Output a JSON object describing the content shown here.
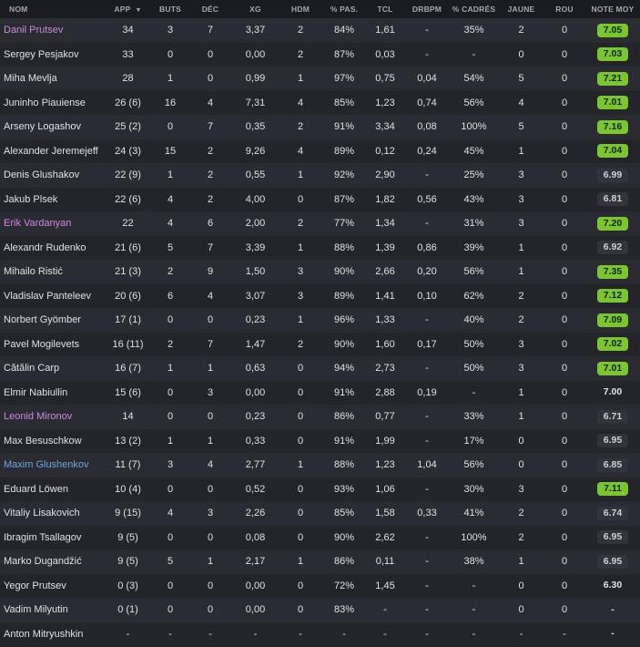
{
  "headers": [
    "NOM",
    "APP",
    "BUTS",
    "DÉC",
    "XG",
    "HDM",
    "% PAS.",
    "TCL",
    "DRBPM",
    "% CADRÉS",
    "JAUNE",
    "ROU",
    "NOTE MOY"
  ],
  "sort_indicator": "▼",
  "colors": {
    "rating_good": "#7bc62d",
    "name_highlight": "#c98ad8",
    "name_loan": "#6aa8e0"
  },
  "players": [
    {
      "name": "Danil Prutsev",
      "name_style": "purple",
      "app": "34",
      "buts": "3",
      "dec": "7",
      "xg": "3,37",
      "hdm": "2",
      "pas": "84%",
      "tcl": "1,61",
      "drbpm": "-",
      "cadres": "35%",
      "jaune": "2",
      "rou": "0",
      "note": "7.05",
      "note_style": "good"
    },
    {
      "name": "Sergey Pesjakov",
      "name_style": "",
      "app": "33",
      "buts": "0",
      "dec": "0",
      "xg": "0,00",
      "hdm": "2",
      "pas": "87%",
      "tcl": "0,03",
      "drbpm": "-",
      "cadres": "-",
      "jaune": "0",
      "rou": "0",
      "note": "7.03",
      "note_style": "good"
    },
    {
      "name": "Miha Mevlja",
      "name_style": "",
      "app": "28",
      "buts": "1",
      "dec": "0",
      "xg": "0,99",
      "hdm": "1",
      "pas": "97%",
      "tcl": "0,75",
      "drbpm": "0,04",
      "cadres": "54%",
      "jaune": "5",
      "rou": "0",
      "note": "7.21",
      "note_style": "good"
    },
    {
      "name": "Juninho Piauiense",
      "name_style": "",
      "app": "26 (6)",
      "buts": "16",
      "dec": "4",
      "xg": "7,31",
      "hdm": "4",
      "pas": "85%",
      "tcl": "1,23",
      "drbpm": "0,74",
      "cadres": "56%",
      "jaune": "4",
      "rou": "0",
      "note": "7.01",
      "note_style": "good"
    },
    {
      "name": "Arseny Logashov",
      "name_style": "",
      "app": "25 (2)",
      "buts": "0",
      "dec": "7",
      "xg": "0,35",
      "hdm": "2",
      "pas": "91%",
      "tcl": "3,34",
      "drbpm": "0,08",
      "cadres": "100%",
      "jaune": "5",
      "rou": "0",
      "note": "7.16",
      "note_style": "good"
    },
    {
      "name": "Alexander Jeremejeff",
      "name_style": "",
      "app": "24 (3)",
      "buts": "15",
      "dec": "2",
      "xg": "9,26",
      "hdm": "4",
      "pas": "89%",
      "tcl": "0,12",
      "drbpm": "0,24",
      "cadres": "45%",
      "jaune": "1",
      "rou": "0",
      "note": "7.04",
      "note_style": "good"
    },
    {
      "name": "Denis Glushakov",
      "name_style": "",
      "app": "22 (9)",
      "buts": "1",
      "dec": "2",
      "xg": "0,55",
      "hdm": "1",
      "pas": "92%",
      "tcl": "2,90",
      "drbpm": "-",
      "cadres": "25%",
      "jaune": "3",
      "rou": "0",
      "note": "6.99",
      "note_style": "normal"
    },
    {
      "name": "Jakub Plsek",
      "name_style": "",
      "app": "22 (6)",
      "buts": "4",
      "dec": "2",
      "xg": "4,00",
      "hdm": "0",
      "pas": "87%",
      "tcl": "1,82",
      "drbpm": "0,56",
      "cadres": "43%",
      "jaune": "3",
      "rou": "0",
      "note": "6.81",
      "note_style": "normal"
    },
    {
      "name": "Erik Vardanyan",
      "name_style": "purple",
      "app": "22",
      "buts": "4",
      "dec": "6",
      "xg": "2,00",
      "hdm": "2",
      "pas": "77%",
      "tcl": "1,34",
      "drbpm": "-",
      "cadres": "31%",
      "jaune": "3",
      "rou": "0",
      "note": "7.20",
      "note_style": "good"
    },
    {
      "name": "Alexandr Rudenko",
      "name_style": "",
      "app": "21 (6)",
      "buts": "5",
      "dec": "7",
      "xg": "3,39",
      "hdm": "1",
      "pas": "88%",
      "tcl": "1,39",
      "drbpm": "0,86",
      "cadres": "39%",
      "jaune": "1",
      "rou": "0",
      "note": "6.92",
      "note_style": "normal"
    },
    {
      "name": "Mihailo Ristić",
      "name_style": "",
      "app": "21 (3)",
      "buts": "2",
      "dec": "9",
      "xg": "1,50",
      "hdm": "3",
      "pas": "90%",
      "tcl": "2,66",
      "drbpm": "0,20",
      "cadres": "56%",
      "jaune": "1",
      "rou": "0",
      "note": "7.35",
      "note_style": "good"
    },
    {
      "name": "Vladislav Panteleev",
      "name_style": "",
      "app": "20 (6)",
      "buts": "6",
      "dec": "4",
      "xg": "3,07",
      "hdm": "3",
      "pas": "89%",
      "tcl": "1,41",
      "drbpm": "0,10",
      "cadres": "62%",
      "jaune": "2",
      "rou": "0",
      "note": "7.12",
      "note_style": "good"
    },
    {
      "name": "Norbert Gyömber",
      "name_style": "",
      "app": "17 (1)",
      "buts": "0",
      "dec": "0",
      "xg": "0,23",
      "hdm": "1",
      "pas": "96%",
      "tcl": "1,33",
      "drbpm": "-",
      "cadres": "40%",
      "jaune": "2",
      "rou": "0",
      "note": "7.09",
      "note_style": "good"
    },
    {
      "name": "Pavel Mogilevets",
      "name_style": "",
      "app": "16 (11)",
      "buts": "2",
      "dec": "7",
      "xg": "1,47",
      "hdm": "2",
      "pas": "90%",
      "tcl": "1,60",
      "drbpm": "0,17",
      "cadres": "50%",
      "jaune": "3",
      "rou": "0",
      "note": "7.02",
      "note_style": "good"
    },
    {
      "name": "Cătălin Carp",
      "name_style": "",
      "app": "16 (7)",
      "buts": "1",
      "dec": "1",
      "xg": "0,63",
      "hdm": "0",
      "pas": "94%",
      "tcl": "2,73",
      "drbpm": "-",
      "cadres": "50%",
      "jaune": "3",
      "rou": "0",
      "note": "7.01",
      "note_style": "good"
    },
    {
      "name": "Elmir Nabiullin",
      "name_style": "",
      "app": "15 (6)",
      "buts": "0",
      "dec": "3",
      "xg": "0,00",
      "hdm": "0",
      "pas": "91%",
      "tcl": "2,88",
      "drbpm": "0,19",
      "cadres": "-",
      "jaune": "1",
      "rou": "0",
      "note": "7.00",
      "note_style": "plain"
    },
    {
      "name": "Leonid Mironov",
      "name_style": "purple",
      "app": "14",
      "buts": "0",
      "dec": "0",
      "xg": "0,23",
      "hdm": "0",
      "pas": "86%",
      "tcl": "0,77",
      "drbpm": "-",
      "cadres": "33%",
      "jaune": "1",
      "rou": "0",
      "note": "6.71",
      "note_style": "normal"
    },
    {
      "name": "Max Besuschkow",
      "name_style": "",
      "app": "13 (2)",
      "buts": "1",
      "dec": "1",
      "xg": "0,33",
      "hdm": "0",
      "pas": "91%",
      "tcl": "1,99",
      "drbpm": "-",
      "cadres": "17%",
      "jaune": "0",
      "rou": "0",
      "note": "6.95",
      "note_style": "normal"
    },
    {
      "name": "Maxim Glushenkov",
      "name_style": "blue",
      "app": "11 (7)",
      "buts": "3",
      "dec": "4",
      "xg": "2,77",
      "hdm": "1",
      "pas": "88%",
      "tcl": "1,23",
      "drbpm": "1,04",
      "cadres": "56%",
      "jaune": "0",
      "rou": "0",
      "note": "6.85",
      "note_style": "normal"
    },
    {
      "name": "Eduard Löwen",
      "name_style": "",
      "app": "10 (4)",
      "buts": "0",
      "dec": "0",
      "xg": "0,52",
      "hdm": "0",
      "pas": "93%",
      "tcl": "1,06",
      "drbpm": "-",
      "cadres": "30%",
      "jaune": "3",
      "rou": "0",
      "note": "7.11",
      "note_style": "good"
    },
    {
      "name": "Vitaliy Lisakovich",
      "name_style": "",
      "app": "9 (15)",
      "buts": "4",
      "dec": "3",
      "xg": "2,26",
      "hdm": "0",
      "pas": "85%",
      "tcl": "1,58",
      "drbpm": "0,33",
      "cadres": "41%",
      "jaune": "2",
      "rou": "0",
      "note": "6.74",
      "note_style": "normal"
    },
    {
      "name": "Ibragim Tsallagov",
      "name_style": "",
      "app": "9 (5)",
      "buts": "0",
      "dec": "0",
      "xg": "0,08",
      "hdm": "0",
      "pas": "90%",
      "tcl": "2,62",
      "drbpm": "-",
      "cadres": "100%",
      "jaune": "2",
      "rou": "0",
      "note": "6.95",
      "note_style": "normal"
    },
    {
      "name": "Marko Dugandžić",
      "name_style": "",
      "app": "9 (5)",
      "buts": "5",
      "dec": "1",
      "xg": "2,17",
      "hdm": "1",
      "pas": "86%",
      "tcl": "0,11",
      "drbpm": "-",
      "cadres": "38%",
      "jaune": "1",
      "rou": "0",
      "note": "6.95",
      "note_style": "normal"
    },
    {
      "name": "Yegor Prutsev",
      "name_style": "",
      "app": "0 (3)",
      "buts": "0",
      "dec": "0",
      "xg": "0,00",
      "hdm": "0",
      "pas": "72%",
      "tcl": "1,45",
      "drbpm": "-",
      "cadres": "-",
      "jaune": "0",
      "rou": "0",
      "note": "6.30",
      "note_style": "plain"
    },
    {
      "name": "Vadim Milyutin",
      "name_style": "",
      "app": "0 (1)",
      "buts": "0",
      "dec": "0",
      "xg": "0,00",
      "hdm": "0",
      "pas": "83%",
      "tcl": "-",
      "drbpm": "-",
      "cadres": "-",
      "jaune": "0",
      "rou": "0",
      "note": "-",
      "note_style": "plain"
    },
    {
      "name": "Anton Mitryushkin",
      "name_style": "",
      "app": "-",
      "buts": "-",
      "dec": "-",
      "xg": "-",
      "hdm": "-",
      "pas": "-",
      "tcl": "-",
      "drbpm": "-",
      "cadres": "-",
      "jaune": "-",
      "rou": "-",
      "note": "-",
      "note_style": "plain"
    }
  ]
}
